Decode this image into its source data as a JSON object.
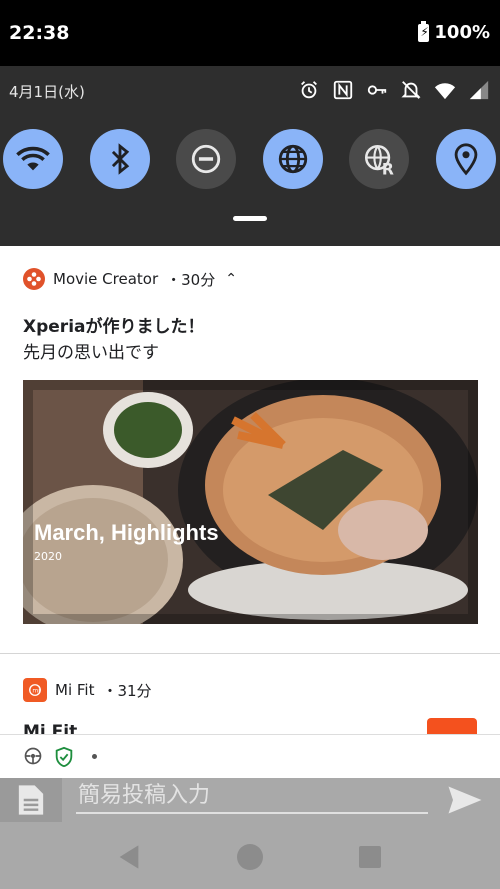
{
  "status_bar": {
    "time": "22:38",
    "battery": "100%"
  },
  "quick_settings": {
    "date": "4月1日(水)",
    "status_icons": [
      "alarm-icon",
      "nfc-icon",
      "vpn-key-icon",
      "notifications-off-icon",
      "wifi-icon",
      "signal-icon"
    ],
    "tiles": [
      {
        "name": "wifi",
        "state": "on"
      },
      {
        "name": "bluetooth",
        "state": "on"
      },
      {
        "name": "do-not-disturb",
        "state": "off"
      },
      {
        "name": "globe",
        "state": "on"
      },
      {
        "name": "roaming",
        "state": "off"
      },
      {
        "name": "location",
        "state": "on"
      }
    ],
    "accent": "#8ab4f8"
  },
  "notification_movie": {
    "app": "Movie Creator",
    "time": "・30分",
    "title": "Xperiaが作りました！",
    "body": "先月の思い出です",
    "image_title": "March, Highlights",
    "image_year": "2020"
  },
  "notification_mifit": {
    "app": "Mi Fit",
    "time": "・31分",
    "title": "Mi Fit"
  },
  "input_bar": {
    "placeholder": "簡易投稿入力"
  }
}
